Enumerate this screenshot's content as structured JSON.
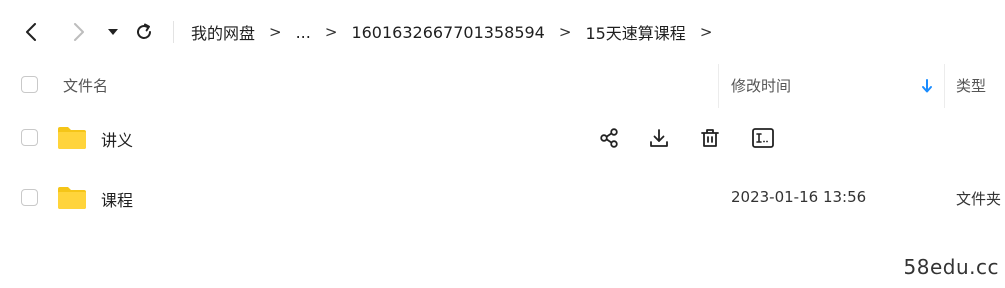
{
  "toolbar": {
    "back_icon": "chevron-left-icon",
    "forward_icon": "chevron-right-icon",
    "history_icon": "caret-down-icon",
    "refresh_icon": "refresh-icon"
  },
  "breadcrumb": {
    "items": [
      "我的网盘",
      "...",
      "1601632667701358594",
      "15天速算课程"
    ],
    "separator": ">"
  },
  "list_header": {
    "name": "文件名",
    "modified": "修改时间",
    "type": "类型",
    "sort_icon": "arrow-down-icon",
    "sort_color": "#1a8cff"
  },
  "rows": [
    {
      "name": "讲义",
      "modified": "",
      "type": "",
      "icon": "folder-icon",
      "hovered": true,
      "actions": [
        "share-icon",
        "download-icon",
        "delete-icon",
        "rename-icon"
      ]
    },
    {
      "name": "课程",
      "modified": "2023-01-16 13:56",
      "type": "文件夹",
      "icon": "folder-icon",
      "hovered": false
    }
  ],
  "colors": {
    "folder": "#ffd43b",
    "folder_dark": "#f5c518"
  },
  "watermark": "58edu.cc"
}
